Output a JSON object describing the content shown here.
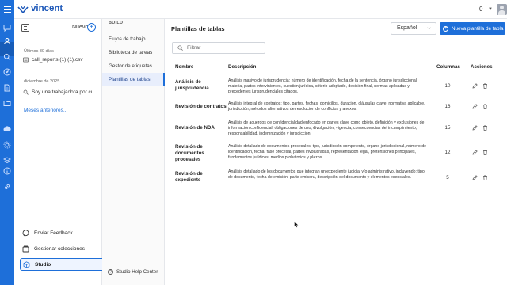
{
  "app": {
    "brand": "vincent",
    "credits": "0"
  },
  "sidebar": {
    "new_label": "Nuevo",
    "groups": [
      {
        "title": "Últimos 30 días",
        "items": [
          {
            "label": "call_reports (1) (1).csv",
            "icon": "file-csv-icon"
          }
        ]
      },
      {
        "title": "diciembre de 2025",
        "items": [
          {
            "label": "Soy una trabajadora por cu...",
            "icon": "search-icon"
          }
        ]
      }
    ],
    "more_months": "Meses anteriores...",
    "bottom": {
      "feedback": "Enviar Feedback",
      "collections": "Gestionar colecciones",
      "studio": "Studio"
    }
  },
  "build_nav": {
    "title": "BUILD",
    "items": [
      "Flujos de trabajo",
      "Biblioteca de tareas",
      "Gestor de etiquetas",
      "Plantillas de tablas"
    ],
    "active_index": 3,
    "help": "Studio Help Center"
  },
  "main": {
    "title": "Plantillas de tablas",
    "language": "Español",
    "new_button": "Nueva plantilla de tabla",
    "filter_placeholder": "Filtrar",
    "columns": {
      "name": "Nombre",
      "description": "Descripción",
      "cols": "Columnas",
      "actions": "Acciones"
    },
    "rows": [
      {
        "name": "Análisis de jurisprudencia",
        "description": "Análisis masivo de jurisprudencia: número de identificación, fecha de la sentencia, órgano jurisdiccional, materia, partes intervinientes, cuestión jurídica, criterio adoptado, decisión final, normas aplicadas y precedentes jurisprudenciales citados.",
        "columns": "10"
      },
      {
        "name": "Revisión de contratos",
        "description": "Análisis integral de contratos: tipo, partes, fechas, domicilios, duración, cláusulas clave, normativa aplicable, jurisdicción, métodos alternativos de resolución de conflictos y anexos.",
        "columns": "16"
      },
      {
        "name": "Revisión de NDA",
        "description": "Análisis de acuerdos de confidencialidad enfocado en partes clave como objeto, definición y exclusiones de información confidencial, obligaciones de uso, divulgación, vigencia, consecuencias del incumplimiento, responsabilidad, indemnización y jurisdicción.",
        "columns": "15"
      },
      {
        "name": "Revisión de documentos procesales",
        "description": "Análisis detallado de documentos procesales: tipo, jurisdicción competente, órgano jurisdiccional, número de identificación, fecha, fase procesal, partes involucradas, representación legal, pretensiones principales, fundamentos jurídicos, medios probatorios y plazos.",
        "columns": "12"
      },
      {
        "name": "Revisión de expediente",
        "description": "Análisis detallado de los documentos que integran un expediente judicial y/o administrativo, incluyendo: tipo de documento, fecha de emisión, parte emisora, descripción del documento y elementos esenciales.",
        "columns": "5"
      }
    ]
  },
  "colors": {
    "primary": "#1e6fd9",
    "rail": "#1e6fd9"
  }
}
